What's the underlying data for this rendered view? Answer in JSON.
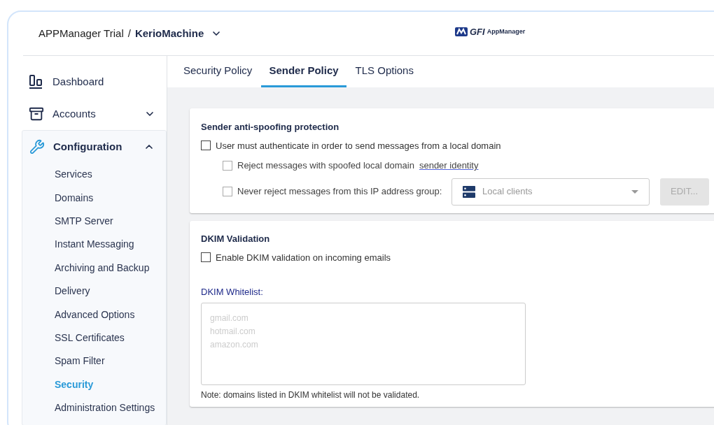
{
  "breadcrumb": {
    "parent": "APPManager Trial",
    "separator": "/",
    "current": "KerioMachine"
  },
  "logo": {
    "brand": "GFI",
    "product": "AppManager"
  },
  "sidebar": {
    "items": [
      {
        "label": "Dashboard",
        "kind": "dashboard"
      },
      {
        "label": "Accounts",
        "kind": "archive",
        "expanded": false
      },
      {
        "label": "Configuration",
        "kind": "wrench",
        "expanded": true,
        "children": [
          {
            "label": "Services",
            "selected": false
          },
          {
            "label": "Domains",
            "selected": false
          },
          {
            "label": "SMTP Server",
            "selected": false
          },
          {
            "label": "Instant Messaging",
            "selected": false
          },
          {
            "label": "Archiving and Backup",
            "selected": false
          },
          {
            "label": "Delivery",
            "selected": false
          },
          {
            "label": "Advanced Options",
            "selected": false
          },
          {
            "label": "SSL Certificates",
            "selected": false
          },
          {
            "label": "Spam Filter",
            "selected": false
          },
          {
            "label": "Security",
            "selected": true
          },
          {
            "label": "Administration Settings",
            "selected": false
          }
        ]
      }
    ]
  },
  "tabs": [
    {
      "label": "Security Policy",
      "selected": false
    },
    {
      "label": "Sender Policy",
      "selected": true
    },
    {
      "label": "TLS Options",
      "selected": false
    }
  ],
  "spoofing": {
    "title": "Sender anti-spoofing protection",
    "authenticate": {
      "label": "User must authenticate in order to send messages from a local domain",
      "checked": false
    },
    "reject": {
      "label": "Reject messages with spoofed local domain",
      "link": "sender identity",
      "checked": false,
      "disabled": true
    },
    "never_reject": {
      "label": "Never reject messages from this IP address group:",
      "checked": false,
      "disabled": true
    },
    "group_select": {
      "value": "Local clients",
      "disabled": true
    },
    "edit_button": {
      "label": "EDIT...",
      "disabled": true
    }
  },
  "dkim": {
    "title": "DKIM Validation",
    "enable": {
      "label": "Enable DKIM validation on incoming emails",
      "checked": false
    },
    "whitelist_label": "DKIM Whitelist:",
    "whitelist": {
      "placeholder": "gmail.com\nhotmail.com\namazon.com"
    },
    "note": "Note: domains listed in DKIM whitelist will not be validated."
  }
}
